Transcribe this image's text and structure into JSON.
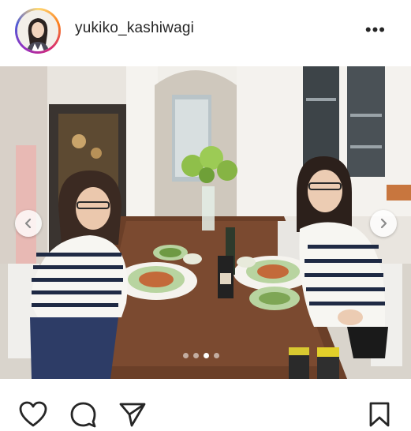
{
  "post": {
    "username": "yukiko_kashiwagi",
    "more_label": "•••"
  },
  "carousel": {
    "prev_icon": "chevron-left-icon",
    "next_icon": "chevron-right-icon",
    "slide_count": 4,
    "active_slide": 3
  },
  "actions": {
    "like_icon": "heart-icon",
    "comment_icon": "comment-icon",
    "share_icon": "send-icon",
    "save_icon": "bookmark-icon"
  },
  "colors": {
    "text": "#262626",
    "ring_gradient": [
      "#feda75",
      "#fa7e1e",
      "#d62976",
      "#962fbf",
      "#4f5bd5"
    ]
  }
}
